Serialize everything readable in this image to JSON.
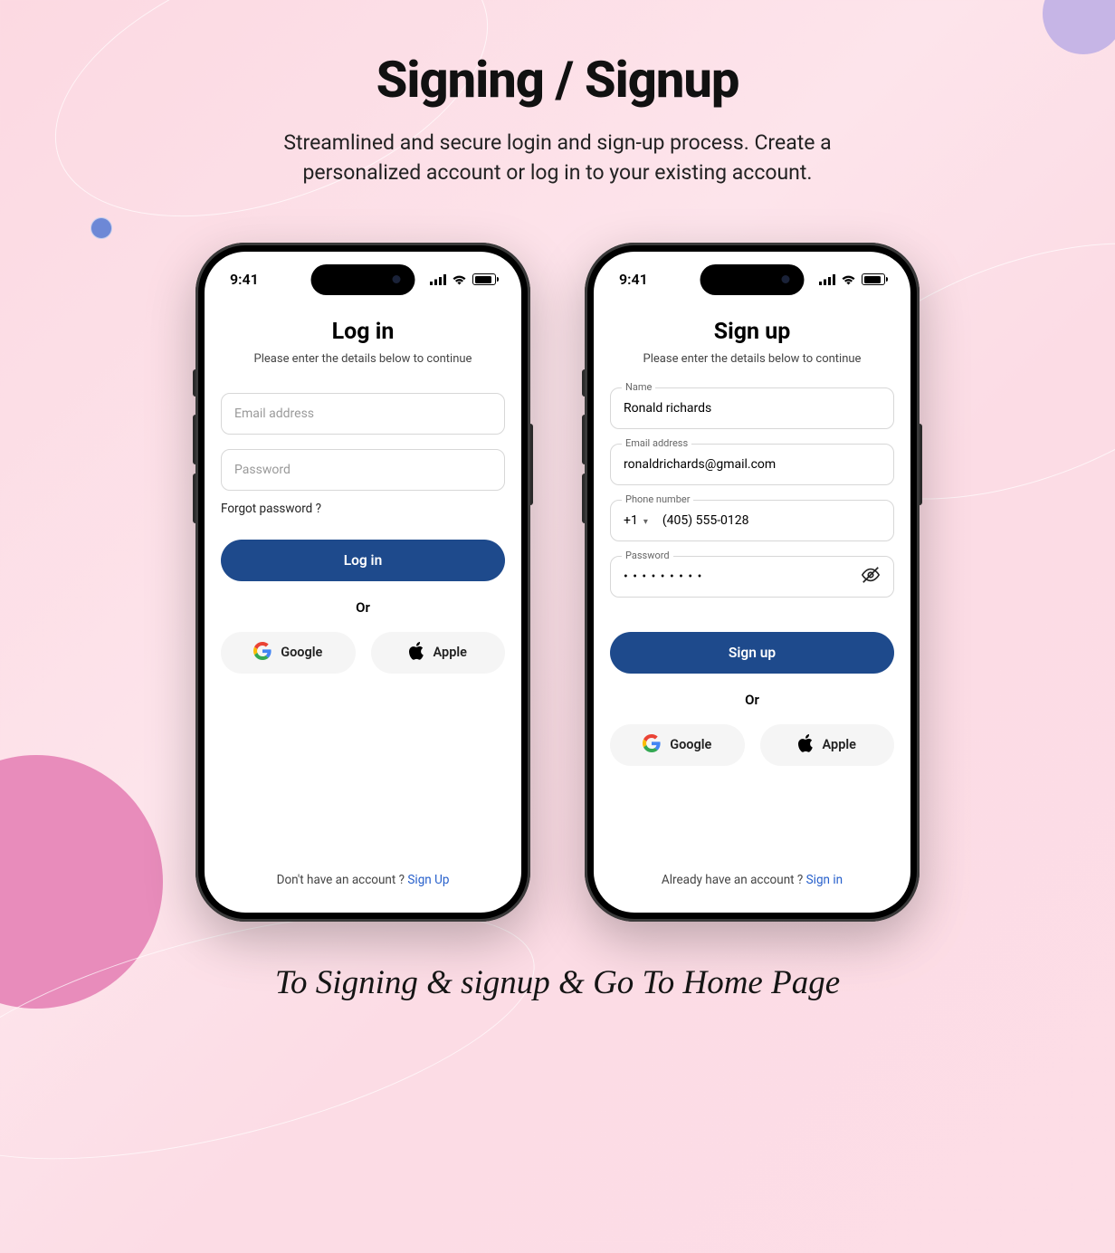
{
  "header": {
    "title": "Signing / Signup",
    "subtitle_line1": "Streamlined and secure login and sign-up process. Create a",
    "subtitle_line2": "personalized account or log in to your existing account."
  },
  "status": {
    "time": "9:41"
  },
  "login": {
    "title": "Log in",
    "subtitle": "Please enter the details below to continue",
    "email_placeholder": "Email address",
    "password_placeholder": "Password",
    "forgot": "Forgot password ?",
    "button": "Log in",
    "or": "Or",
    "google": "Google",
    "apple": "Apple",
    "footer_text": "Don't have an account ? ",
    "footer_link": "Sign Up"
  },
  "signup": {
    "title": "Sign up",
    "subtitle": "Please enter the details below to continue",
    "name_label": "Name",
    "name_value": "Ronald richards",
    "email_label": "Email address",
    "email_value": "ronaldrichards@gmail.com",
    "phone_label": "Phone number",
    "phone_code": "+1",
    "phone_value": "(405) 555-0128",
    "password_label": "Password",
    "password_masked": "• • • • • • • • •",
    "button": "Sign up",
    "or": "Or",
    "google": "Google",
    "apple": "Apple",
    "footer_text": "Already have an account ? ",
    "footer_link": "Sign in"
  },
  "caption": "To Signing & signup & Go To Home Page"
}
